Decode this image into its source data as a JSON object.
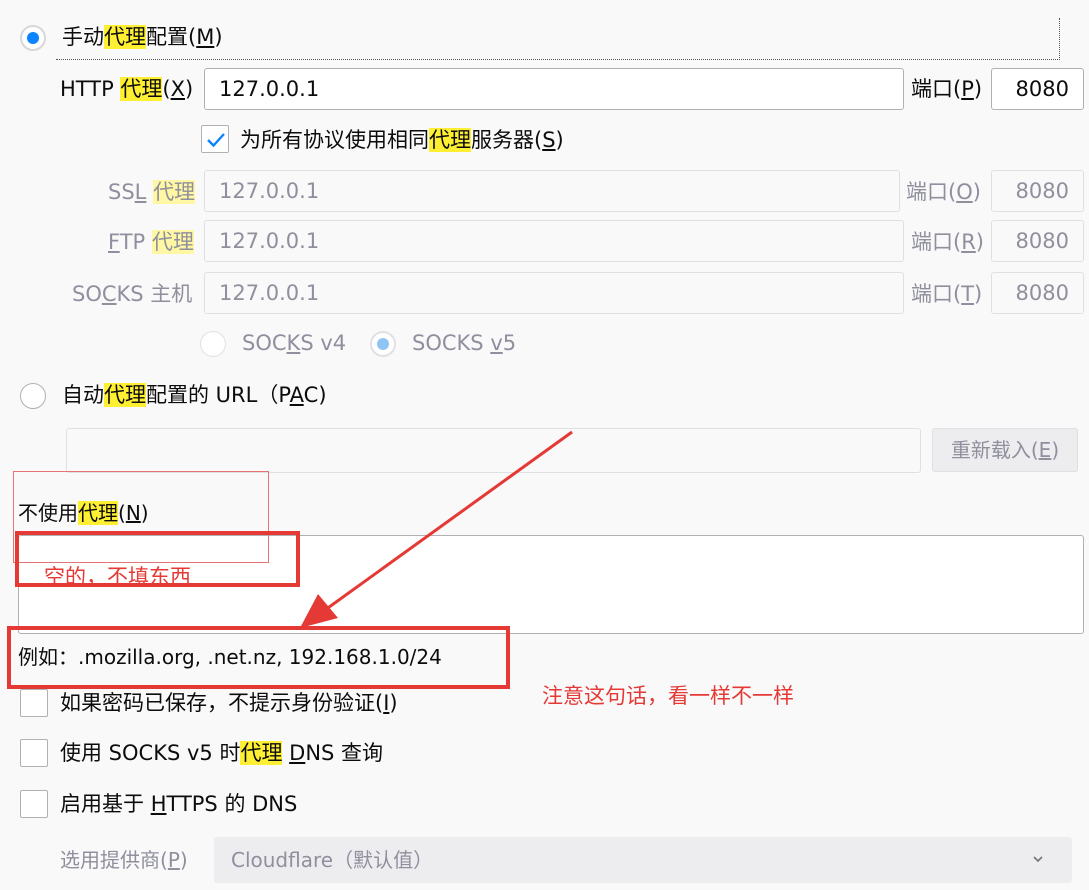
{
  "manual": {
    "label_pre": "手动",
    "label_hl": "代理",
    "label_post": "配置(",
    "label_key": "M",
    "label_end": ")"
  },
  "http": {
    "label_pre": "HTTP ",
    "label_hl": "代理",
    "label_open": "(",
    "label_key": "X",
    "label_close": ")",
    "value": "127.0.0.1",
    "port_label_pre": "端口(",
    "port_key": "P",
    "port_label_post": ")",
    "port": "8080"
  },
  "same_proxy": {
    "label_pre": "为所有协议使用相同",
    "label_hl": "代理",
    "label_post": "服务器(",
    "label_key": "S",
    "label_end": ")"
  },
  "ssl": {
    "label_pre": "SS",
    "label_key": "L",
    "label_sp": " ",
    "label_hl": "代理",
    "value": "127.0.0.1",
    "port_label_pre": "端口(",
    "port_key": "O",
    "port_label_post": ")",
    "port": "8080"
  },
  "ftp": {
    "label_key": "F",
    "label_pre": "TP ",
    "label_hl": "代理",
    "value": "127.0.0.1",
    "port_label_pre": "端口(",
    "port_key": "R",
    "port_label_post": ")",
    "port": "8080"
  },
  "socks": {
    "label_pre": "SO",
    "label_key": "C",
    "label_post": "KS 主机",
    "value": "127.0.0.1",
    "port_label_pre": "端口(",
    "port_key": "T",
    "port_label_post": ")",
    "port": "8080",
    "v4_pre": "SOC",
    "v4_key": "K",
    "v4_post": "S v4",
    "v5_pre": "SOCKS ",
    "v5_key": "v",
    "v5_post": "5"
  },
  "pac": {
    "label_pre": "自动",
    "label_hl": "代理",
    "label_post": "配置的 URL（P",
    "label_key": "A",
    "label_end": "C)",
    "reload_pre": "重新载入(",
    "reload_key": "E",
    "reload_post": ")"
  },
  "no_proxy": {
    "label_pre": "不使用",
    "label_hl": "代理",
    "label_open": "(",
    "label_key": "N",
    "label_close": ")",
    "example": "例如：.mozilla.org, .net.nz, 192.168.1.0/24"
  },
  "options": {
    "no_auth_pre": "如果密码已保存，不提示身份验证(",
    "no_auth_key": "I",
    "no_auth_post": ")",
    "socks_dns_pre": "使用 SOCKS v5 时",
    "socks_dns_hl": "代理",
    "socks_dns_sp": " ",
    "socks_dns_key": "D",
    "socks_dns_post": "NS 查询",
    "doh_pre": "启用基于 ",
    "doh_key": "H",
    "doh_post": "TTPS 的 DNS"
  },
  "provider": {
    "label_pre": "选用提供商(",
    "label_key": "P",
    "label_post": ")",
    "selected": "Cloudflare（默认值）"
  },
  "annotations": {
    "empty_note": "空的，不填东西",
    "notice_note": "注意这句话，看一样不一样"
  },
  "colors": {
    "highlight": "#ffef33",
    "accent": "#0a84ff",
    "annotation_red": "#e53935"
  }
}
